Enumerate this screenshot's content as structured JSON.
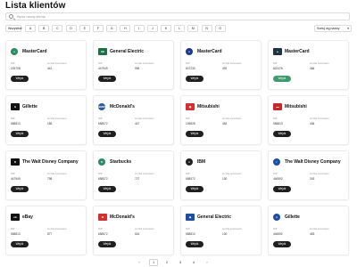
{
  "page": {
    "title": "Lista klientów"
  },
  "search": {
    "placeholder": "Wpisz nazwę klienta"
  },
  "filters": {
    "all_label": "Wszystkie",
    "letters": [
      "A",
      "B",
      "C",
      "D",
      "E",
      "F",
      "G",
      "H",
      "I",
      "J",
      "K",
      "L",
      "M",
      "N",
      "O"
    ],
    "sort_label": "Sortuj wg nazwy",
    "sort_icon": "chevron-down-icon"
  },
  "card_labels": {
    "nip": "NIP",
    "employees": "Liczba zamówień",
    "button": "Wejdź"
  },
  "cards": [
    {
      "name": "MasterCard",
      "nip": "225708",
      "count": "441",
      "logo": {
        "text": "●",
        "color": "#2b8a62",
        "round": true
      },
      "button_color": "#1f1f1f"
    },
    {
      "name": "General Electric",
      "nip": "447949",
      "count": "996",
      "logo": {
        "text": "GE",
        "color": "#1f6e45",
        "round": false
      },
      "button_color": "#1f1f1f"
    },
    {
      "name": "MasterCard",
      "nip": "607230",
      "count": "492",
      "logo": {
        "text": "●",
        "color": "#1a3a8a",
        "round": true
      },
      "button_color": "#1f1f1f"
    },
    {
      "name": "MasterCard",
      "nip": "822476",
      "count": "466",
      "logo": {
        "text": "▲",
        "color": "#1f3340",
        "round": false
      },
      "button_color": "#3d9a6c"
    },
    {
      "name": "Gillette",
      "nip": "558813",
      "count": "185",
      "logo": {
        "text": "G",
        "color": "#111111",
        "round": false
      },
      "button_color": "#1f1f1f"
    },
    {
      "name": "McDonald's",
      "nip": "658572",
      "count": "447",
      "logo": {
        "text": "BMW",
        "color": "#2c5aa0",
        "round": true
      },
      "button_color": "#1f1f1f"
    },
    {
      "name": "Mitsubishi",
      "nip": "105828",
      "count": "453",
      "logo": {
        "text": "◉",
        "color": "#d32f2f",
        "round": false
      },
      "button_color": "#1f1f1f"
    },
    {
      "name": "Mitsubishi",
      "nip": "558813",
      "count": "436",
      "logo": {
        "text": "▬",
        "color": "#c62828",
        "round": false
      },
      "button_color": "#1f1f1f"
    },
    {
      "name": "The Walt Disney Company",
      "nip": "447949",
      "count": "798",
      "logo": {
        "text": "D",
        "color": "#111111",
        "round": false
      },
      "button_color": "#1f1f1f"
    },
    {
      "name": "Starbucks",
      "nip": "658572",
      "count": "727",
      "logo": {
        "text": "★",
        "color": "#2b8a62",
        "round": true
      },
      "button_color": "#1f1f1f"
    },
    {
      "name": "IBM",
      "nip": "658572",
      "count": "130",
      "logo": {
        "text": "●",
        "color": "#222222",
        "round": true
      },
      "button_color": "#1f1f1f"
    },
    {
      "name": "The Walt Disney Company",
      "nip": "446592",
      "count": "243",
      "logo": {
        "text": "◐",
        "color": "#1f4fa0",
        "round": true
      },
      "button_color": "#1f1f1f"
    },
    {
      "name": "eBay",
      "nip": "558813",
      "count": "877",
      "logo": {
        "text": "eb",
        "color": "#111111",
        "round": false
      },
      "button_color": "#1f1f1f"
    },
    {
      "name": "McDonald's",
      "nip": "658572",
      "count": "616",
      "logo": {
        "text": "M",
        "color": "#d32f2f",
        "round": false
      },
      "button_color": "#1f1f1f"
    },
    {
      "name": "General Electric",
      "nip": "558813",
      "count": "130",
      "logo": {
        "text": "◆",
        "color": "#1f4fa0",
        "round": false
      },
      "button_color": "#1f1f1f"
    },
    {
      "name": "Gillette",
      "nip": "446592",
      "count": "453",
      "logo": {
        "text": "●",
        "color": "#1f4fa0",
        "round": true
      },
      "button_color": "#1f1f1f"
    }
  ],
  "pagination": {
    "pages": [
      "1",
      "2",
      "3",
      "4"
    ],
    "active": "1",
    "next_icon": "chevron-right-icon",
    "next_glyph": "›"
  }
}
